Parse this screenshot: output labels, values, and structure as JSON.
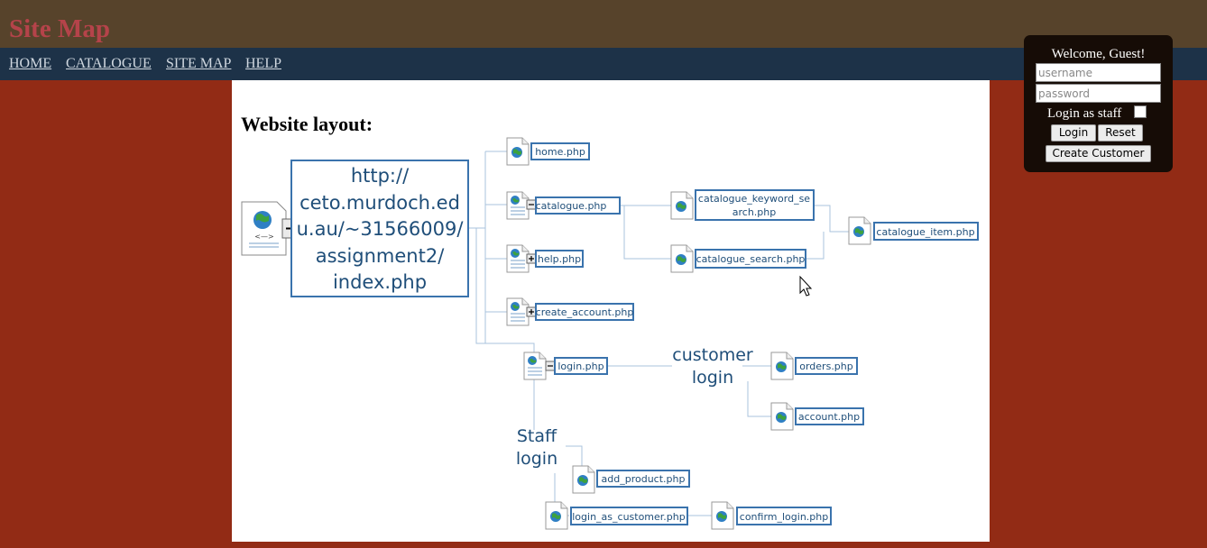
{
  "header": {
    "title": "Site Map"
  },
  "nav": {
    "items": [
      "HOME",
      "CATALOGUE",
      "SITE MAP",
      "HELP"
    ]
  },
  "content": {
    "heading": "Website layout:"
  },
  "login": {
    "welcome": "Welcome, Guest!",
    "username_placeholder": "username",
    "password_placeholder": "password",
    "staff_label": "Login as staff",
    "login_button": "Login",
    "reset_button": "Reset",
    "create_button": "Create Customer"
  },
  "diagram": {
    "root_lines": [
      "http://",
      "ceto.murdoch.ed",
      "u.au/~31566009/",
      "assignment2/",
      "index.php"
    ],
    "pages": {
      "home": "home.php",
      "catalogue": "catalogue.php",
      "help": "help.php",
      "create_account": "create_account.php",
      "catalogue_keyword_line1": "catalogue_keyword_se",
      "catalogue_keyword_line2": "arch.php",
      "catalogue_search": "catalogue_search.php",
      "catalogue_item": "catalogue_item.php",
      "login": "login.php",
      "orders": "orders.php",
      "account": "account.php",
      "add_product": "add_product.php",
      "login_as_customer": "login_as_customer.php",
      "confirm_login": "confirm_login.php"
    },
    "customer_login_line1": "customer",
    "customer_login_line2": "login",
    "staff_login_line1": "Staff",
    "staff_login_line2": "login"
  },
  "colors": {
    "header": "#57432b",
    "nav": "#1d3248",
    "page_bg": "#922b15",
    "title": "#b5434a",
    "node_border": "#3a73ad",
    "node_text": "#1f4e79"
  }
}
